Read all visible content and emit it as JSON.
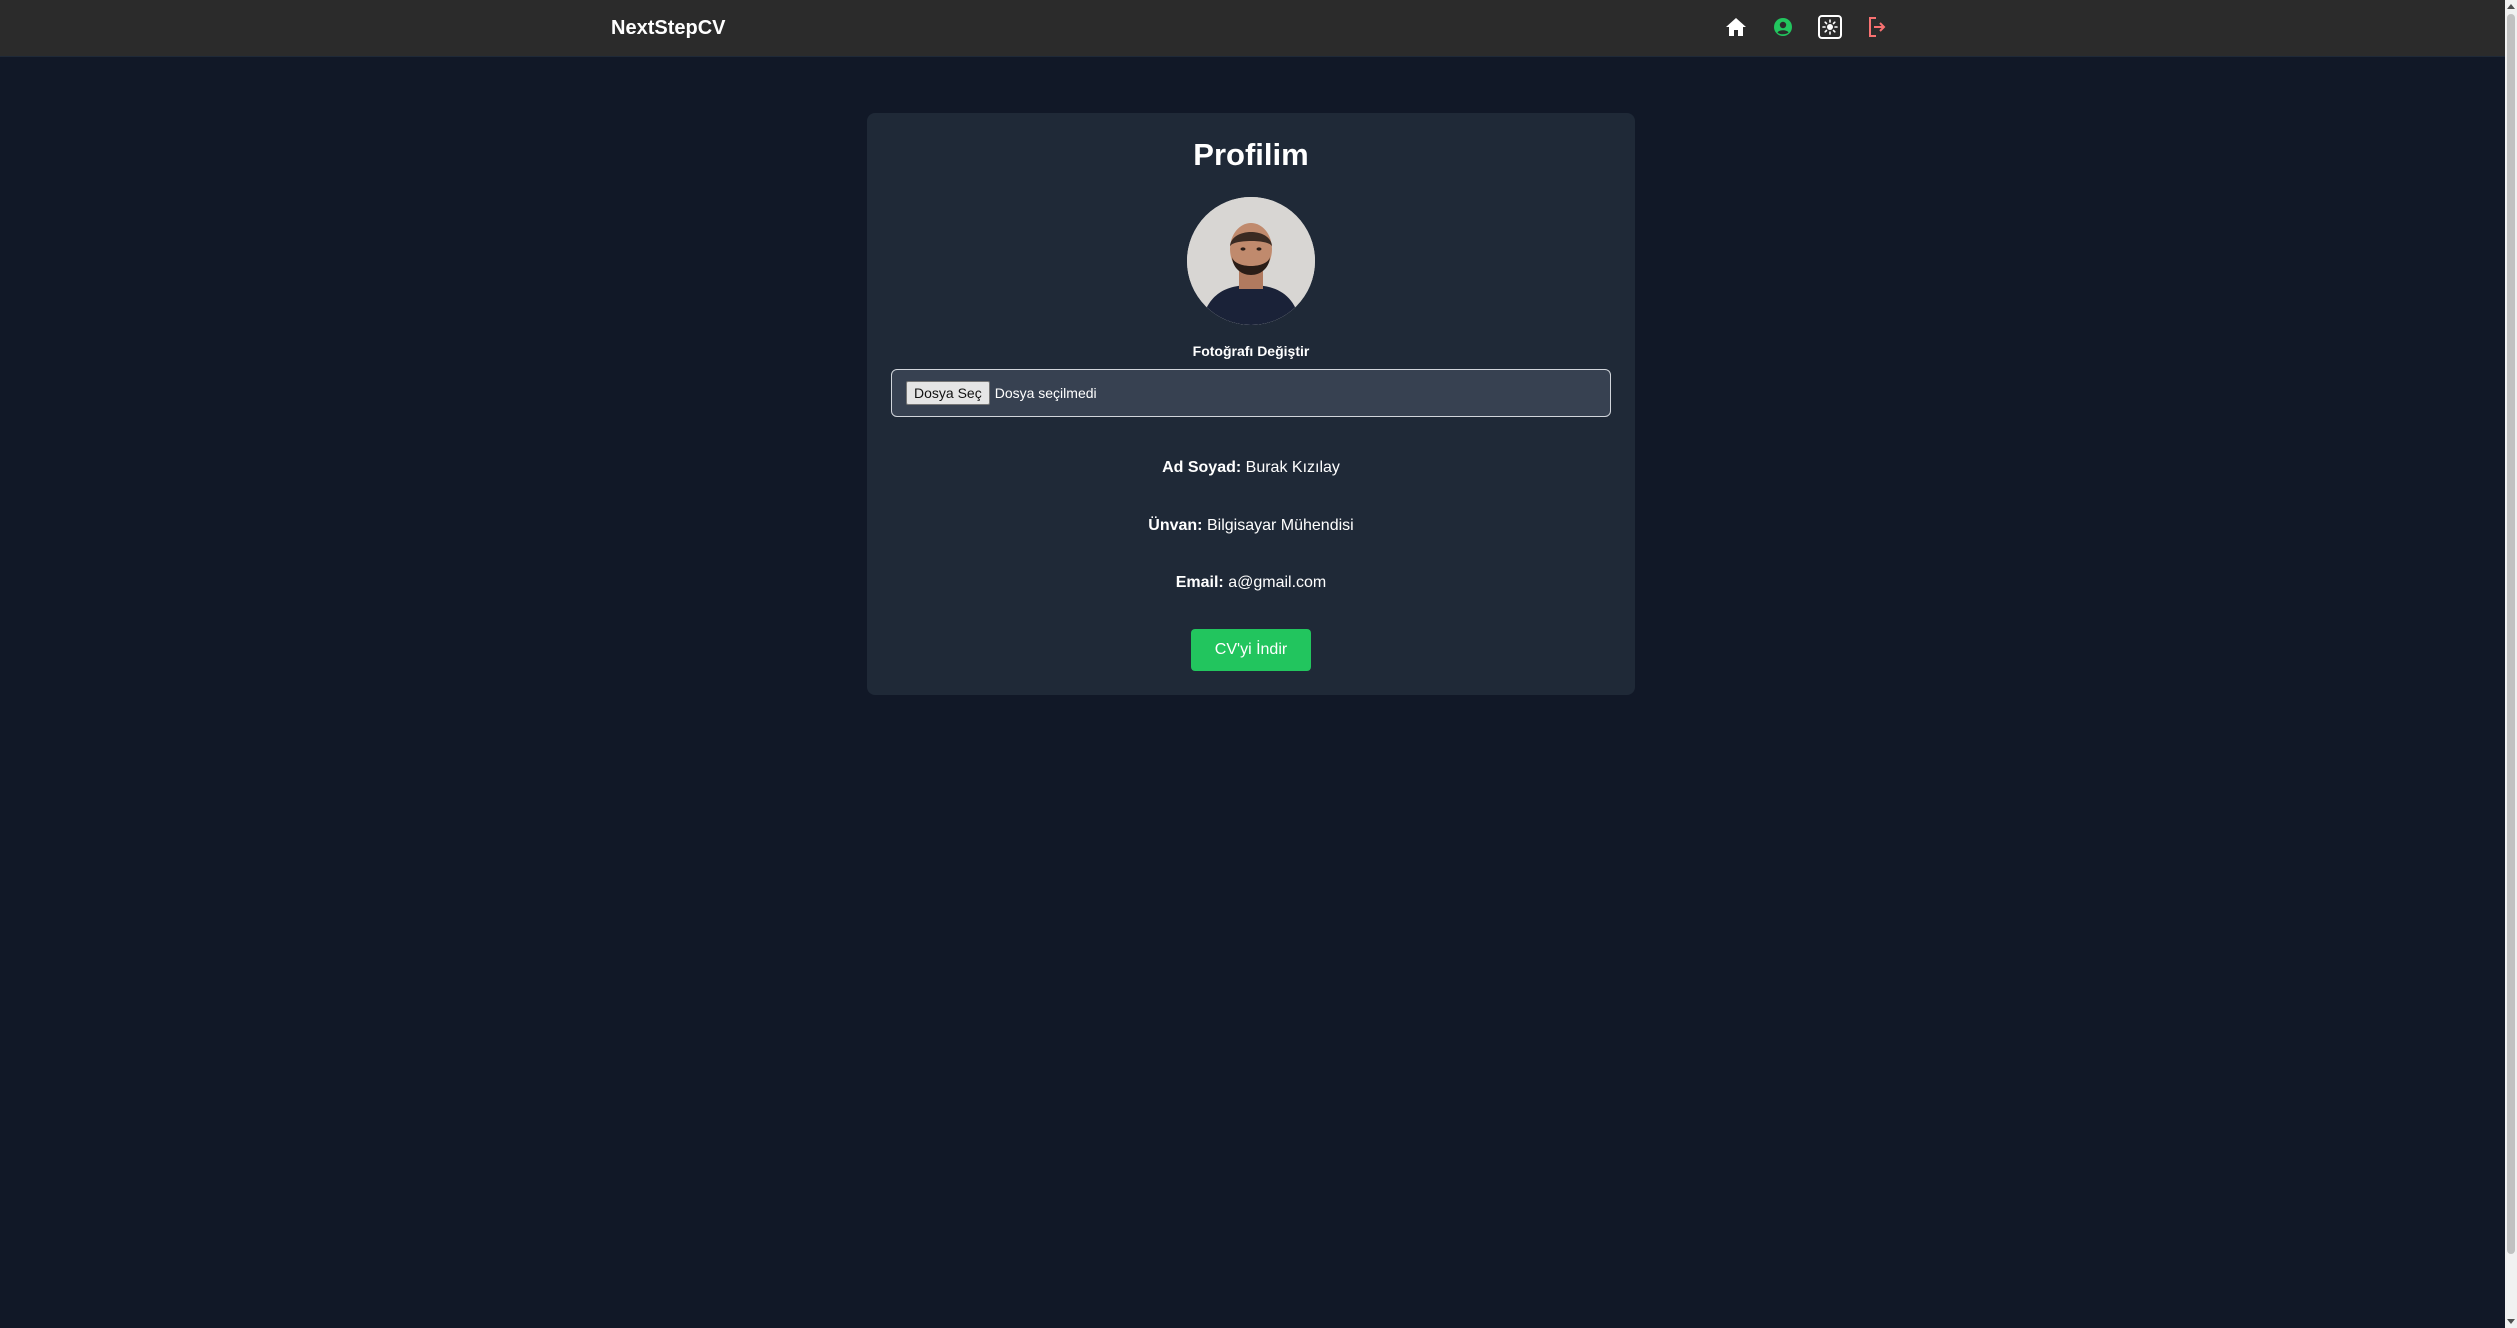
{
  "navbar": {
    "brand": "NextStepCV",
    "icons": [
      "home-icon",
      "user-circle-icon",
      "theme-toggle-icon",
      "logout-icon"
    ],
    "colors": {
      "background": "#2b2b2b",
      "user_icon": "#22c55e",
      "logout_icon": "#f87171"
    }
  },
  "profile": {
    "title": "Profilim",
    "change_photo_label": "Fotoğrafı Değiştir",
    "file_button_label": "Dosya Seç",
    "file_status": "Dosya seçilmedi",
    "fields": [
      {
        "label": "Ad Soyad:",
        "value": "Burak Kızılay"
      },
      {
        "label": "Ünvan:",
        "value": "Bilgisayar Mühendisi"
      },
      {
        "label": "Email:",
        "value": "a@gmail.com"
      }
    ],
    "download_label": "CV'yi İndir"
  },
  "colors": {
    "page_background": "#111827",
    "card_background": "#1f2937",
    "accent_green": "#22c55e"
  }
}
